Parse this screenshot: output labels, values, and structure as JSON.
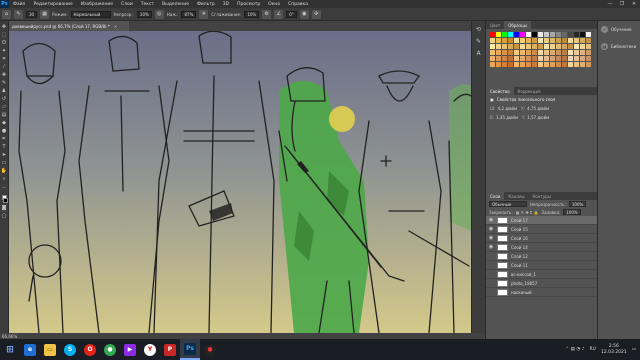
{
  "app": {
    "logo": "Ps",
    "menu": [
      "Файл",
      "Редактирование",
      "Изображение",
      "Слои",
      "Текст",
      "Выделение",
      "Фильтр",
      "3D",
      "Просмотр",
      "Окно",
      "Справка"
    ],
    "window_controls": [
      "—",
      "❐",
      "✕"
    ]
  },
  "options": {
    "brush_size": "30",
    "mode_label": "Режим:",
    "mode_value": "Нормальный",
    "opacity_label": "Непрозр.:",
    "opacity_value": "30%",
    "flow_label": "Наж.:",
    "flow_value": "87%",
    "smoothing_label": "Сглаживание:",
    "smoothing_value": "10%",
    "angle_value": "0°"
  },
  "document": {
    "tab_title": "доввишийрусс.psd @ 66,7% (Слой 17, RGB/8) *",
    "tab_close": "×",
    "status": "66,66%"
  },
  "right_panel": {
    "tabs": [
      "Цвет",
      "Образцы"
    ],
    "active_tab": "Образцы",
    "swatch_colors": [
      "#ff0000",
      "#ffff00",
      "#00ff00",
      "#00ffff",
      "#0000ff",
      "#ff00ff",
      "#ffffff",
      "#000000",
      "#e8e8e8",
      "#c8c8c8",
      "#a8a8a8",
      "#888888",
      "#686868",
      "#484848",
      "#282828",
      "#101010",
      "#f0f0f0",
      "#f2d47a",
      "#e8b94a",
      "#d9a13a",
      "#c98a2c",
      "#f4e3a1",
      "#f7cf6a",
      "#e6b452",
      "#d49a3e",
      "#f5e7b8",
      "#e9cf86",
      "#dcb865",
      "#c9a04f",
      "#b5893c",
      "#f0dba0",
      "#e4c57e",
      "#d3ad5e",
      "#c09448",
      "#fbe8a6",
      "#f1d48a",
      "#e6bf6f",
      "#d8aa58",
      "#c79544",
      "#f7dc97",
      "#ecc77b",
      "#ddb061",
      "#cc9a4c",
      "#f9e5b0",
      "#efd192",
      "#e2bb75",
      "#d3a45d",
      "#c28f48",
      "#fae9ba",
      "#f0d59b",
      "#e4c07d",
      "#f5c06a",
      "#eaa957",
      "#dc9347",
      "#cd7e39",
      "#f8ce84",
      "#eeb86c",
      "#e1a257",
      "#d28c45",
      "#f3d9a8",
      "#e9c28a",
      "#dbab6f",
      "#cc9458",
      "#bd7f44",
      "#f6e0b8",
      "#ecc99a",
      "#dfb27e",
      "#d09b65",
      "#eab26b",
      "#dc9a56",
      "#cd8444",
      "#bd6f35",
      "#f0c184",
      "#e4a96c",
      "#d69257",
      "#c67c44",
      "#efd0a8",
      "#e3b88b",
      "#d5a170",
      "#c58a58",
      "#b67544",
      "#f2d8b8",
      "#e7c19b",
      "#d9aa80",
      "#ca9367",
      "#f0a850",
      "#e39440",
      "#d58033",
      "#c66c27",
      "#f4b86a",
      "#e9a356",
      "#dc8f45",
      "#cd7a36",
      "#f6c98a",
      "#eab571",
      "#dea05b",
      "#d08b48",
      "#c17738",
      "#f8d6a2",
      "#edc288",
      "#e1ad71",
      "#d3985c"
    ],
    "properties_tabs": [
      "Свойства",
      "Коррекция"
    ],
    "properties_title": "Свойства пиксельного слоя",
    "props": [
      {
        "k": "Ш:",
        "v": "4,2 дюйм"
      },
      {
        "k": "X:",
        "v": "4,75 дюйм"
      },
      {
        "k": "В:",
        "v": "1,35 дюйм"
      },
      {
        "k": "Y:",
        "v": "1,57 дюйм"
      }
    ],
    "layers_tabs": [
      "Слои",
      "Каналы",
      "Контуры"
    ],
    "blend_mode": "Обычные",
    "opacity_label": "Непрозрачность:",
    "opacity_value": "100%",
    "lock_label": "Закрепить:",
    "fill_label": "Заливка:",
    "fill_value": "100%",
    "layers": [
      {
        "name": "Слой 17",
        "visible": true,
        "selected": true
      },
      {
        "name": "Слой 15",
        "visible": true,
        "selected": false
      },
      {
        "name": "Слой 16",
        "visible": true,
        "selected": false
      },
      {
        "name": "Слой 14",
        "visible": true,
        "selected": false
      },
      {
        "name": "Слой 12",
        "visible": false,
        "selected": false
      },
      {
        "name": "Слой 11",
        "visible": false,
        "selected": false
      },
      {
        "name": "вс-киссой_1",
        "visible": false,
        "selected": false
      },
      {
        "name": "photo_18657",
        "visible": false,
        "selected": false
      },
      {
        "name": "наскиный",
        "visible": false,
        "selected": false
      }
    ]
  },
  "far_panel": {
    "buttons": [
      "Обучение",
      "Библиотеки"
    ]
  },
  "taskbar": {
    "apps": [
      "⊞",
      "e",
      "📁",
      "S",
      "O",
      "●",
      "▶",
      "Y",
      "P",
      "Ps",
      "●"
    ],
    "lang": "RU",
    "time": "2:56",
    "date": "12.03.2021"
  }
}
